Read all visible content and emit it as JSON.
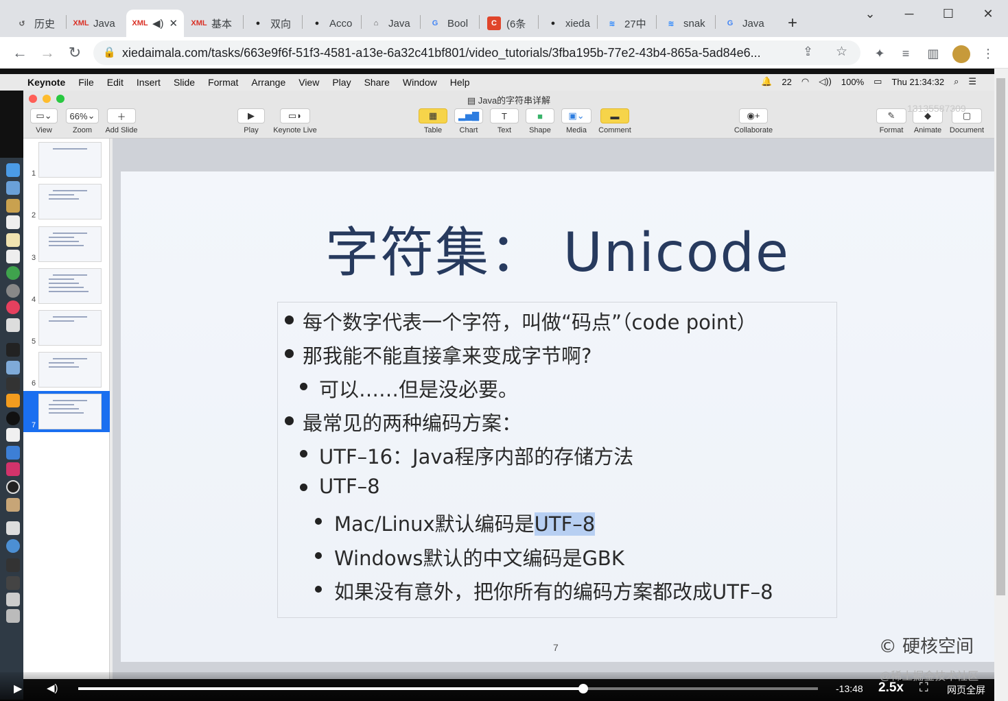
{
  "browser": {
    "tabs": [
      {
        "label": "历史",
        "icon": "history-icon",
        "active": false
      },
      {
        "label": "Java",
        "icon": "xml-icon",
        "active": false
      },
      {
        "label": "",
        "icon": "xml-icon",
        "active": true
      },
      {
        "label": "基本",
        "icon": "xml-icon",
        "active": false
      },
      {
        "label": "双向",
        "icon": "github-icon",
        "active": false
      },
      {
        "label": "Acco",
        "icon": "github-icon",
        "active": false
      },
      {
        "label": "Java",
        "icon": "book-icon",
        "active": false
      },
      {
        "label": "Bool",
        "icon": "google-icon",
        "active": false
      },
      {
        "label": "(6条",
        "icon": "c-icon",
        "active": false
      },
      {
        "label": "xieda",
        "icon": "github-icon",
        "active": false
      },
      {
        "label": "27中",
        "icon": "juejin-icon",
        "active": false
      },
      {
        "label": "snak",
        "icon": "juejin-icon",
        "active": false
      },
      {
        "label": "Java",
        "icon": "google-icon",
        "active": false
      }
    ],
    "url": "xiedaimala.com/tasks/663e9f6f-51f3-4581-a13e-6a32c41bf801/video_tutorials/3fba195b-77e2-43b4-865a-5ad84e6..."
  },
  "menubar": {
    "app": "Keynote",
    "items": [
      "File",
      "Edit",
      "Insert",
      "Slide",
      "Format",
      "Arrange",
      "View",
      "Play",
      "Share",
      "Window",
      "Help"
    ],
    "notif_count": "22",
    "battery": "100%",
    "clock": "Thu 21:34:32"
  },
  "keynote": {
    "window_title": "Java的字符串详解",
    "toolbar": {
      "view": "View",
      "zoom_value": "66%",
      "zoom": "Zoom",
      "add_slide": "Add Slide",
      "play": "Play",
      "keynote_live": "Keynote Live",
      "table": "Table",
      "chart": "Chart",
      "text": "Text",
      "shape": "Shape",
      "media": "Media",
      "comment": "Comment",
      "collaborate": "Collaborate",
      "format": "Format",
      "animate": "Animate",
      "document": "Document"
    },
    "slide_numbers": [
      "1",
      "2",
      "3",
      "4",
      "5",
      "6",
      "7"
    ],
    "slide": {
      "title": "字符集：  Unicode",
      "bullets": {
        "b1": "每个数字代表一个字符，叫做“码点”（code point）",
        "b2": "那我能不能直接拿来变成字节啊?",
        "b2_1": "可以……但是没必要。",
        "b3": "最常见的两种编码方案：",
        "b3_1": "UTF–16：Java程序内部的存储方法",
        "b3_2": "UTF–8",
        "b3_2_1_pre": "Mac/Linux默认编码是",
        "b3_2_1_sel": "UTF–8",
        "b3_2_2": "Windows默认的中文编码是GBK",
        "b3_2_3": "如果没有意外，把你所有的编码方案都改成UTF–8"
      },
      "page_number": "7",
      "brand": "© 硬核空间"
    }
  },
  "player": {
    "remaining": "-13:48",
    "speed": "2.5x",
    "fullscreen_label": "网页全屏",
    "progress": 0.683
  },
  "watermarks": {
    "top": "13135587309",
    "bottom": "@稀土掘金技术社区"
  }
}
